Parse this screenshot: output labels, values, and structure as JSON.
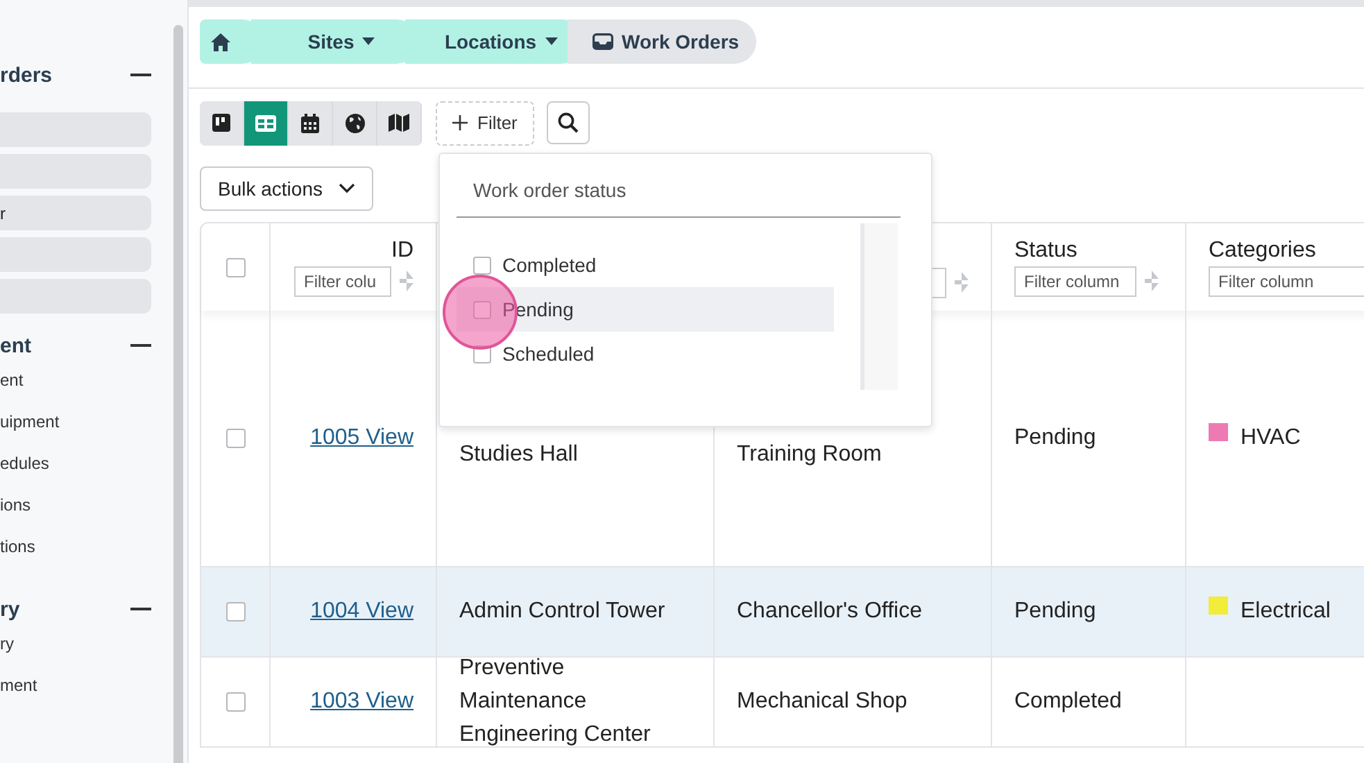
{
  "sidebar": {
    "sections": [
      {
        "title": "rders",
        "expanded": true,
        "items": [
          {
            "kind": "pill"
          },
          {
            "kind": "pill"
          },
          {
            "kind": "pill",
            "label": "r"
          },
          {
            "kind": "pill"
          },
          {
            "kind": "pill"
          }
        ]
      },
      {
        "title": "ent",
        "expanded": true,
        "items": [
          {
            "kind": "link",
            "label": "ent"
          },
          {
            "kind": "link",
            "label": "uipment"
          },
          {
            "kind": "link",
            "label": "edules"
          },
          {
            "kind": "link",
            "label": "ions"
          },
          {
            "kind": "link",
            "label": "tions"
          }
        ]
      },
      {
        "title": "ry",
        "expanded": true,
        "items": [
          {
            "kind": "link",
            "label": "ry"
          },
          {
            "kind": "link",
            "label": "ment"
          }
        ]
      }
    ]
  },
  "breadcrumb": [
    {
      "kind": "home"
    },
    {
      "kind": "menu",
      "label": "Sites"
    },
    {
      "kind": "menu",
      "label": "Locations"
    },
    {
      "kind": "current",
      "label": "Work Orders"
    }
  ],
  "view_buttons": [
    {
      "kind": "board",
      "selected": false
    },
    {
      "kind": "table",
      "selected": true
    },
    {
      "kind": "calendar",
      "selected": false
    },
    {
      "kind": "globe",
      "selected": false
    },
    {
      "kind": "map",
      "selected": false
    }
  ],
  "filter_button": {
    "label": "Filter"
  },
  "bulk_actions": {
    "label": "Bulk actions"
  },
  "filter_popup": {
    "title": "Work order status",
    "options": [
      {
        "label": "Completed",
        "checked": false,
        "highlighted": false
      },
      {
        "label": "Pending",
        "checked": false,
        "highlighted": true
      },
      {
        "label": "Scheduled",
        "checked": false,
        "highlighted": false
      }
    ]
  },
  "table": {
    "columns": [
      {
        "kind": "select",
        "checked": false
      },
      {
        "kind": "id",
        "label": "ID",
        "filter_placeholder": "Filter colu"
      },
      {
        "kind": "hidden"
      },
      {
        "kind": "hidden_filter"
      },
      {
        "kind": "text",
        "label": "Status",
        "filter_placeholder": "Filter column"
      },
      {
        "kind": "wide",
        "label": "Categories",
        "filter_placeholder": "Filter column"
      }
    ],
    "rows": [
      {
        "checked": false,
        "id": "1005 View",
        "title": "Studies Hall",
        "location": "Training Room",
        "status": "Pending",
        "category": {
          "label": "HVAC",
          "color": "#ee7ab4"
        },
        "tall": true,
        "shaded": false
      },
      {
        "checked": false,
        "id": "1004 View",
        "title": "Admin Control Tower",
        "location": "Chancellor's Office",
        "status": "Pending",
        "category": {
          "label": "Electrical",
          "color": "#f2ec3a"
        },
        "tall": false,
        "shaded": true
      },
      {
        "checked": false,
        "id": "1003 View",
        "title": "Preventive Maintenance Engineering Center",
        "location": "Mechanical Shop",
        "status": "Completed",
        "tall": false,
        "shaded": false
      }
    ]
  }
}
